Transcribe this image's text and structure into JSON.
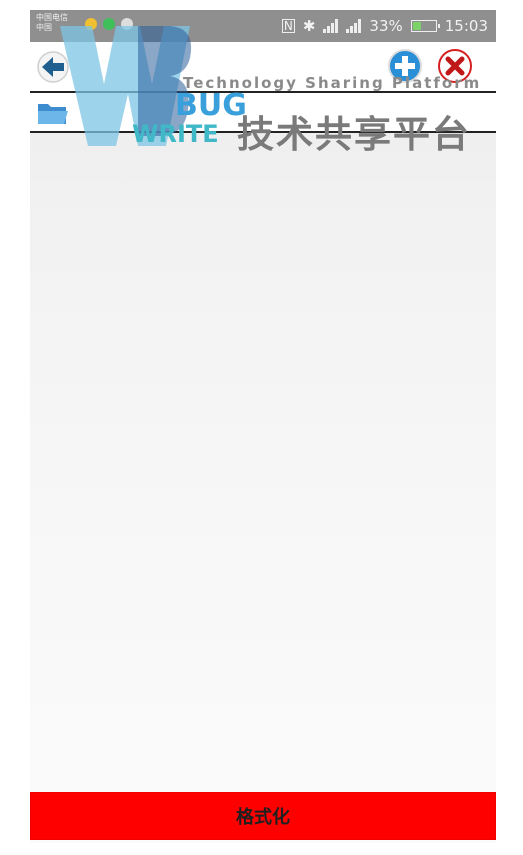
{
  "statusbar": {
    "carrier_top": "中国电信",
    "carrier_bottom": "中国",
    "battery_percent": "33%",
    "battery_level": 0.33,
    "time": "15:03",
    "nfc": "N"
  },
  "watermark": {
    "tagline": "Technology Sharing Platform",
    "cn_title": "技术共享平台",
    "bug": "BUG",
    "write": "WRITE"
  },
  "actions": {
    "format_label": "格式化"
  },
  "icons": {
    "back": "back-arrow-icon",
    "add": "plus-icon",
    "close": "close-icon",
    "folder": "folder-icon"
  },
  "colors": {
    "format_button": "#ff0000",
    "statusbar": "#8f8f8f",
    "add_button": "#2a8fd6",
    "close_button": "#d42020"
  }
}
